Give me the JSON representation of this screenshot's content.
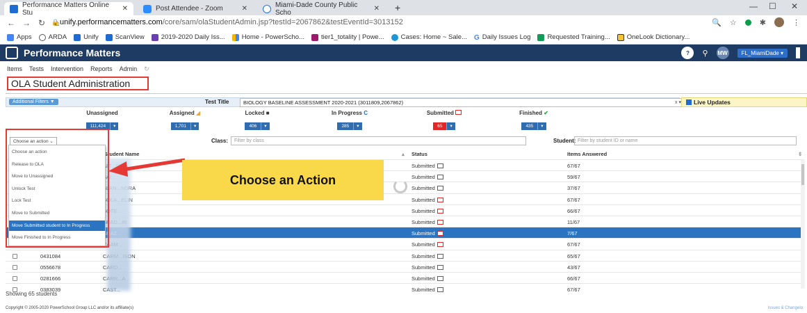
{
  "browser": {
    "tabs": [
      {
        "title": "Performance Matters Online Stu",
        "active": true,
        "color": "#1e6bd1"
      },
      {
        "title": "Post Attendee - Zoom",
        "active": false,
        "color": "#2d8cff"
      },
      {
        "title": "Miami-Dade County Public Scho",
        "active": false,
        "color": "#1a73e8"
      }
    ],
    "url_host": "unify.performancematters.com",
    "url_path": "/core/sam/olaStudentAdmin.jsp?testId=2067862&testEventId=3013152",
    "bookmarks": [
      "Apps",
      "ARDA",
      "Unify",
      "ScanView",
      "2019-2020 Daily Iss...",
      "Home - PowerScho...",
      "tier1_totality | Powe...",
      "Cases: Home ~ Sale...",
      "Daily Issues Log",
      "Requested Training...",
      "OneLook Dictionary..."
    ]
  },
  "app": {
    "brand": "Performance Matters",
    "user_initials": "MW",
    "org": "FL_MiamiDade ▾",
    "menu": [
      "Items",
      "Tests",
      "Intervention",
      "Reports",
      "Admin"
    ],
    "page_title": "OLA Student Administration"
  },
  "filters": {
    "additional_filters": "Additional Filters ▼",
    "test_title_label": "Test Title",
    "test_title_value": "BIOLOGY BASELINE ASSESSMENT 2020-2021 (3011809,2067862)",
    "clear": "x ▾",
    "live_updates": "Live Updates"
  },
  "statuses": [
    {
      "label": "Unassigned",
      "count": "111,424"
    },
    {
      "label": "Assigned",
      "count": "1,701"
    },
    {
      "label": "Locked",
      "count": "406"
    },
    {
      "label": "In Progress",
      "count": "285"
    },
    {
      "label": "Submitted",
      "count": "65"
    },
    {
      "label": "Finished",
      "count": "435"
    }
  ],
  "toolbar": {
    "action_placeholder": "Choose an action",
    "class_label": "Class:",
    "class_placeholder": "Filter by class",
    "student_label": "Student:",
    "student_placeholder": "Filter by student ID or name"
  },
  "table": {
    "headers": {
      "name": "Student Name",
      "status": "Status",
      "items": "Items Answered"
    },
    "rows": [
      {
        "id": "",
        "name": "ALT...SICA",
        "status": "Submitted",
        "items": "67/67"
      },
      {
        "id": "",
        "name": "BAI...",
        "status": "Submitted",
        "items": "59/67"
      },
      {
        "id": "",
        "name": "BLAN...NDRA",
        "status": "Submitted",
        "items": "37/67"
      },
      {
        "id": "",
        "name": "BOLA...ELIN",
        "status": "Submitted",
        "items": "67/67"
      },
      {
        "id": "",
        "name": "BOTE...",
        "status": "Submitted",
        "items": "66/67"
      },
      {
        "id": "",
        "name": "BRAD...RI",
        "status": "Submitted",
        "items": "11/67"
      },
      {
        "id": "",
        "name": "BRAZ...",
        "status": "Submitted",
        "items": "7/67",
        "selected": true
      },
      {
        "id": "",
        "name": "CAAM...",
        "status": "Submitted",
        "items": "67/67"
      },
      {
        "id": "0431084",
        "name": "CARM...ISON",
        "status": "Submitted",
        "items": "65/67"
      },
      {
        "id": "0556678",
        "name": "CARD...",
        "status": "Submitted",
        "items": "43/67"
      },
      {
        "id": "0281666",
        "name": "CARR...A",
        "status": "Submitted",
        "items": "66/67"
      },
      {
        "id": "0383039",
        "name": "CAST...",
        "status": "Submitted",
        "items": "67/67"
      }
    ],
    "showing": "Showing 65 students"
  },
  "dropdown": {
    "items": [
      "Choose an action",
      "Release to OLA",
      "Move to Unassigned",
      "Unlock Test",
      "Lock Test",
      "Move to Submitted",
      "Move Submitted student to In Progress",
      "Move Finished to In Progress"
    ],
    "highlighted_index": 6
  },
  "annotation": {
    "callout": "Choose an Action"
  },
  "footer": {
    "copyright": "Copyright © 2005-2020 PowerSchool Group LLC and/or its affiliate(s)",
    "link": "Issues & Changelo"
  },
  "colors": {
    "header": "#1d3b63",
    "accent": "#2a74c2",
    "submitted": "#e12727",
    "callout": "#f9d949"
  }
}
